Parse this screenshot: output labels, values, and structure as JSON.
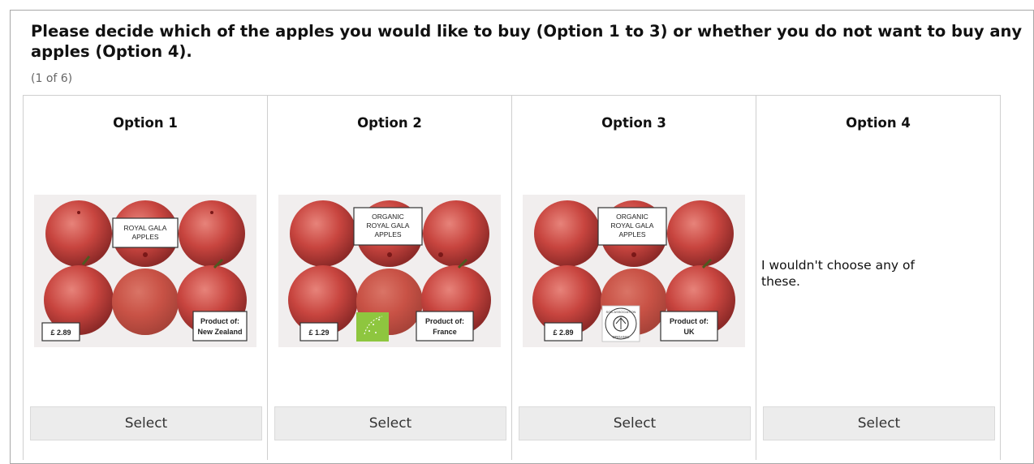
{
  "question": "Please decide which of the apples you would like to buy (Option 1 to 3) or whether you do not want to buy any apples (Option 4).",
  "counter": "(1 of 6)",
  "options": [
    {
      "title": "Option 1",
      "label_lines": [
        "ROYAL GALA",
        "APPLES"
      ],
      "price": "£ 2.89",
      "origin_line1": "Product of:",
      "origin_line2": "New Zealand",
      "organic_logo": "none",
      "select_label": "Select"
    },
    {
      "title": "Option 2",
      "label_lines": [
        "ORGANIC",
        "ROYAL GALA",
        "APPLES"
      ],
      "price": "£ 1.29",
      "origin_line1": "Product of:",
      "origin_line2": "France",
      "organic_logo": "eu-organic-leaf-icon",
      "select_label": "Select"
    },
    {
      "title": "Option 3",
      "label_lines": [
        "ORGANIC",
        "ROYAL GALA",
        "APPLES"
      ],
      "price": "£ 2.89",
      "origin_line1": "Product of:",
      "origin_line2": "UK",
      "organic_logo": "soil-association-organic-icon",
      "soil_logo_top": "SOIL ASSOCIATION",
      "soil_logo_bottom": "ORGANIC",
      "select_label": "Select"
    },
    {
      "title": "Option 4",
      "text": "I wouldn't choose any of these.",
      "select_label": "Select"
    }
  ],
  "colors": {
    "apple_red": "#c8453f",
    "tray_bg": "#f1eeee",
    "eu_green": "#8ec63f",
    "button_bg": "#ececec",
    "border": "#cfcfcf"
  }
}
